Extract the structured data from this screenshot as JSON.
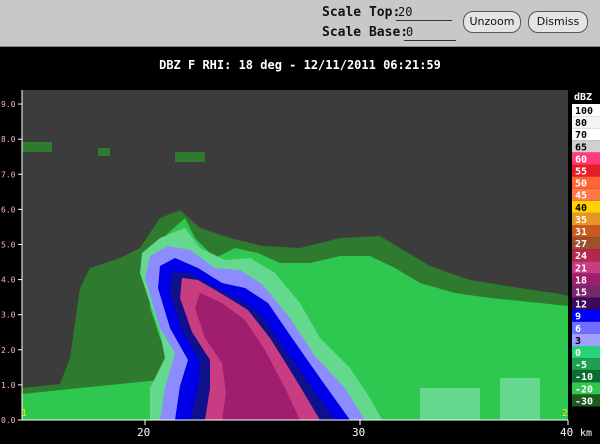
{
  "toolbar": {
    "scale_top_label": "Scale Top:",
    "scale_top_value": "20",
    "scale_base_label": "Scale Base:",
    "scale_base_value": "0",
    "unzoom_label": "Unzoom",
    "dismiss_label": "Dismiss"
  },
  "plot": {
    "title": "DBZ F  RHI: 18 deg  -  12/11/2011 06:21:59",
    "y_ticks": [
      "0.0",
      "1.0",
      "2.0",
      "3.0",
      "4.0",
      "5.0",
      "6.0",
      "7.0",
      "8.0",
      "9.0"
    ],
    "x_ticks": [
      "20",
      "30",
      "40"
    ],
    "x_unit": "km",
    "corner_left": "1",
    "corner_right": "2",
    "colors": {
      "background": "#3c3c3c",
      "dark_green": "#2e7a2e",
      "green": "#2ec850",
      "light_green": "#64d88c",
      "light_blue": "#8c8cff",
      "blue": "#0000e8",
      "dark_blue": "#10108c",
      "pink": "#c83c82",
      "magenta": "#a01e6e"
    }
  },
  "colorbar": {
    "unit": "dBZ",
    "levels": [
      {
        "label": "100",
        "color": "#ffffff"
      },
      {
        "label": "80",
        "color": "#f4f4f4"
      },
      {
        "label": "70",
        "color": "#ffffff"
      },
      {
        "label": "65",
        "color": "#d0d0d0"
      },
      {
        "label": "60",
        "color": "#ff3c78"
      },
      {
        "label": "55",
        "color": "#e61e28"
      },
      {
        "label": "50",
        "color": "#ff6432"
      },
      {
        "label": "45",
        "color": "#ff7846"
      },
      {
        "label": "40",
        "color": "#ffd200"
      },
      {
        "label": "35",
        "color": "#e69628"
      },
      {
        "label": "31",
        "color": "#c85a1e"
      },
      {
        "label": "27",
        "color": "#a05028"
      },
      {
        "label": "24",
        "color": "#b42850"
      },
      {
        "label": "21",
        "color": "#c83c82"
      },
      {
        "label": "18",
        "color": "#a01e6e"
      },
      {
        "label": "15",
        "color": "#78286e"
      },
      {
        "label": "12",
        "color": "#3c0a5a"
      },
      {
        "label": "9",
        "color": "#0000ff"
      },
      {
        "label": "6",
        "color": "#6e6eff"
      },
      {
        "label": "3",
        "color": "#a0a0ff"
      },
      {
        "label": "0",
        "color": "#28d278"
      },
      {
        "label": "-5",
        "color": "#1ea050"
      },
      {
        "label": "-10",
        "color": "#0a6e32"
      },
      {
        "label": "-20",
        "color": "#32c850"
      },
      {
        "label": "-30",
        "color": "#1e5a1e"
      }
    ]
  }
}
